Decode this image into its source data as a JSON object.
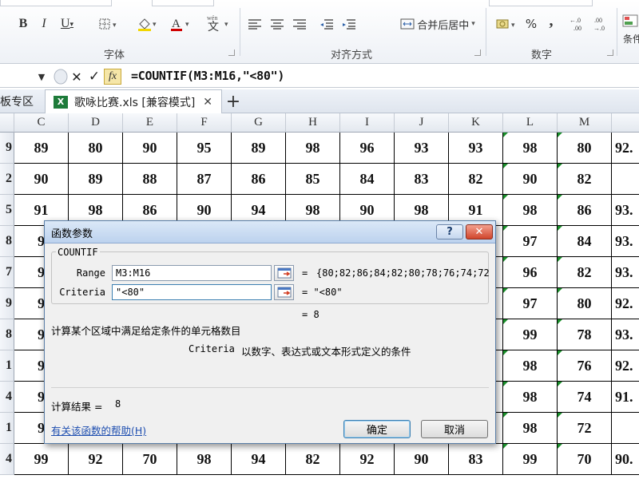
{
  "ribbon": {
    "group_labels": [
      "字体",
      "对齐方式",
      "数字"
    ],
    "merge_center_label": "合并后居中",
    "percent_symbol": "%",
    "comma_symbol": ",",
    "decimal_increase": "+.0\n.00",
    "decimal_decrease": ".00\n→.0",
    "conditional_fmt": "条件"
  },
  "formula_bar": {
    "cancel_symbol": "✕",
    "enter_symbol": "✓",
    "fx_label": "fx",
    "formula": "=COUNTIF(M3:M16,\"<80\")"
  },
  "tabs": {
    "prev_tab": "板专区",
    "active_tab": "歌咏比赛.xls [兼容模式]",
    "excel_badge": "X",
    "new_tab_symbol": "+",
    "close_symbol": "✕"
  },
  "grid": {
    "columns": [
      "C",
      "D",
      "E",
      "F",
      "G",
      "H",
      "I",
      "J",
      "K",
      "L",
      "M",
      ""
    ],
    "row_headers": [
      "9",
      "2",
      "5",
      "8",
      "7",
      "9",
      "8",
      "1",
      "4",
      "1",
      "4"
    ],
    "rows": [
      [
        "89",
        "80",
        "90",
        "95",
        "89",
        "98",
        "96",
        "93",
        "93",
        "98",
        "80",
        "92."
      ],
      [
        "90",
        "89",
        "88",
        "87",
        "86",
        "85",
        "84",
        "83",
        "82",
        "90",
        "82",
        ""
      ],
      [
        "91",
        "98",
        "86",
        "90",
        "94",
        "98",
        "90",
        "98",
        "91",
        "98",
        "86",
        "93."
      ],
      [
        "9",
        "",
        "",
        "",
        "",
        "",
        "",
        "",
        "",
        "97",
        "84",
        "93."
      ],
      [
        "9",
        "",
        "",
        "",
        "",
        "",
        "",
        "",
        "",
        "96",
        "82",
        "93."
      ],
      [
        "9",
        "",
        "",
        "",
        "",
        "",
        "",
        "",
        "",
        "97",
        "80",
        "92."
      ],
      [
        "9",
        "",
        "",
        "",
        "",
        "",
        "",
        "",
        "",
        "99",
        "78",
        "93."
      ],
      [
        "9",
        "",
        "",
        "",
        "",
        "",
        "",
        "",
        "",
        "98",
        "76",
        "92."
      ],
      [
        "9",
        "",
        "",
        "",
        "",
        "",
        "",
        "",
        "",
        "98",
        "74",
        "91."
      ],
      [
        "9",
        "",
        "",
        "",
        "",
        "",
        "",
        "",
        "",
        "98",
        "72",
        ""
      ],
      [
        "99",
        "92",
        "70",
        "98",
        "94",
        "82",
        "92",
        "90",
        "83",
        "99",
        "70",
        "90."
      ]
    ]
  },
  "dialog": {
    "title": "函数参数",
    "help_symbol": "?",
    "close_symbol": "✕",
    "function_name": "COUNTIF",
    "range_label": "Range",
    "range_value": "M3:M16",
    "range_result": "{80;82;86;84;82;80;78;76;74;72",
    "criteria_label": "Criteria",
    "criteria_value": "\"<80\"",
    "criteria_result": "= \"<80\"",
    "equals": "=",
    "overall_result": "= 8",
    "description": "计算某个区域中满足给定条件的单元格数目",
    "arg_help_name": "Criteria",
    "arg_help_text": "以数字、表达式或文本形式定义的条件",
    "calc_result_label": "计算结果 =",
    "calc_result_value": "8",
    "help_link": "有关该函数的帮助(H)",
    "ok_label": "确定",
    "cancel_label": "取消"
  },
  "colors": {
    "dialog_border": "#5b7fa8",
    "title_gradient_top": "#dbe8f7",
    "link": "#1f4fb0",
    "error_triangle": "#1a8f2a"
  }
}
